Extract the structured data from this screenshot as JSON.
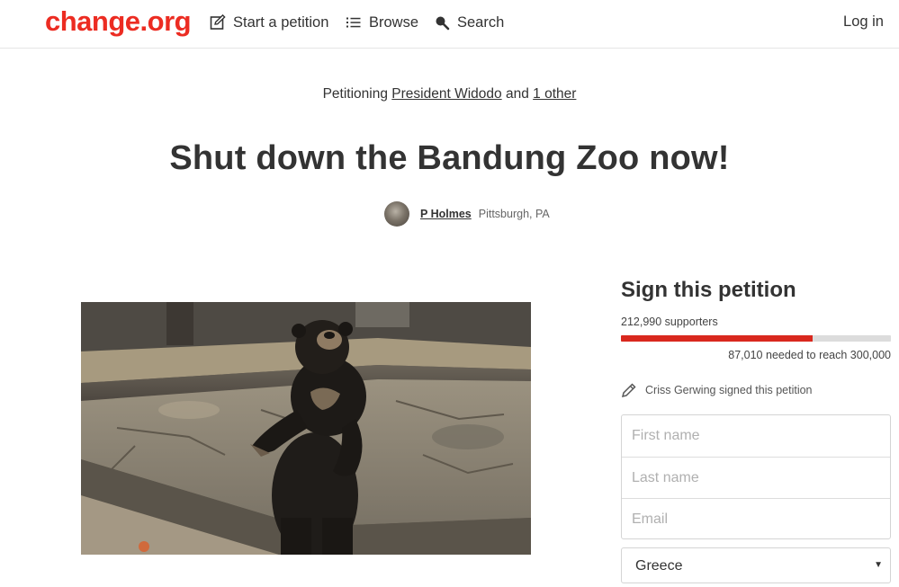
{
  "header": {
    "logo": "change.org",
    "nav": {
      "start_petition": "Start a petition",
      "browse": "Browse",
      "search": "Search"
    },
    "login": "Log in"
  },
  "petition": {
    "petitioning_prefix": "Petitioning",
    "target": "President Widodo",
    "conjunction": "and",
    "other_targets": "1 other",
    "title": "Shut down the Bandung Zoo now!",
    "author_name": "P Holmes",
    "author_location": "Pittsburgh, PA"
  },
  "sidebar": {
    "heading": "Sign this petition",
    "supporters": "212,990 supporters",
    "progress_fraction": 0.71,
    "needed": "87,010 needed to reach 300,000",
    "recent_signer": "Criss Gerwing signed this petition",
    "form": {
      "first_name_placeholder": "First name",
      "last_name_placeholder": "Last name",
      "email_placeholder": "Email",
      "country_value": "Greece"
    }
  },
  "colors": {
    "brand": "#ec2c22",
    "progress_fill": "#d9281e",
    "progress_track": "#dcdcdc"
  },
  "icons": [
    "edit-icon",
    "list-icon",
    "search-icon",
    "pencil-icon",
    "chevron-down-icon"
  ]
}
